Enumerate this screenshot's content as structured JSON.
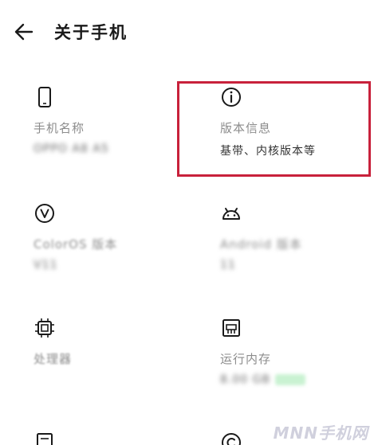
{
  "header": {
    "title": "关于手机"
  },
  "cards": {
    "phone_name": {
      "label": "手机名称",
      "value": "OPPO A8 A5"
    },
    "version_info": {
      "label": "版本信息",
      "value": "基带、内核版本等"
    },
    "coloros": {
      "label": "ColorOS 版本",
      "value": "V11"
    },
    "android": {
      "label": "Android 版本",
      "value": "11"
    },
    "processor": {
      "label": "处理器",
      "value": ""
    },
    "ram": {
      "label": "运行内存",
      "value": "8.00 GB"
    }
  },
  "watermark": "MNN手机网",
  "colors": {
    "highlight_border": "#c8213b",
    "label_gray": "#8c8c8c"
  }
}
